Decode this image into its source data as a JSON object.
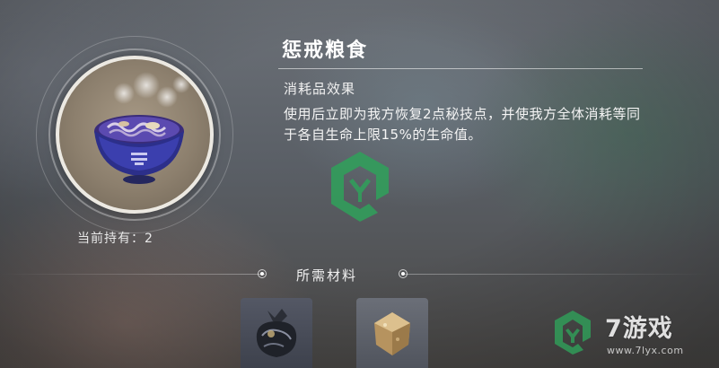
{
  "item": {
    "name": "惩戒粮食",
    "category": "消耗品效果",
    "description": "使用后立即为我方恢复2点秘技点，并使我方全体消耗等同于各自生命上限15%的生命值。",
    "owned_label": "当前持有：2",
    "owned_count": 2,
    "icon": "purple-noodle-bowl-icon"
  },
  "materials": {
    "title": "所需材料",
    "slots": [
      {
        "icon": "dark-cloth-bundle-icon"
      },
      {
        "icon": "tan-crystal-cube-icon"
      }
    ]
  },
  "watermark": {
    "name": "7游戏",
    "url": "www.7lyx.com"
  },
  "colors": {
    "accent_green": "#2fa15a",
    "bowl_purple": "#4a3a9a",
    "ring_white": "#ece9e2"
  }
}
